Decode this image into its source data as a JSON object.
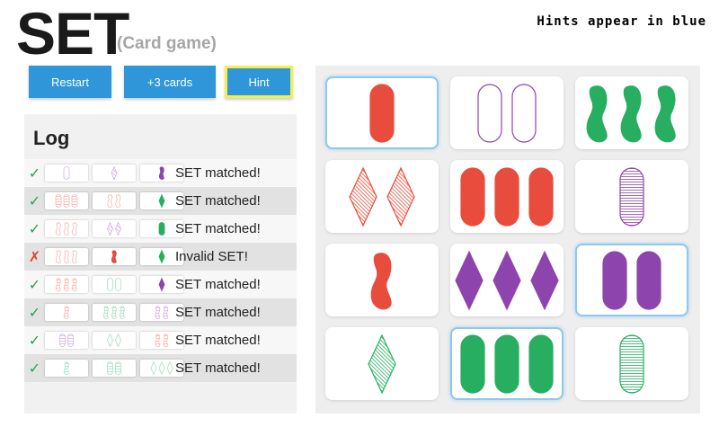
{
  "header": {
    "title": "SET",
    "subtitle": "(Card game)",
    "hint_note": "Hints appear in blue"
  },
  "toolbar": {
    "restart_label": "Restart",
    "add_cards_label": "+3 cards",
    "hint_label": "Hint"
  },
  "colors": {
    "red": "#e74c3c",
    "purple": "#8e44ad",
    "green": "#27ae60",
    "button": "#2f97d9",
    "hint_outline": "#f5ef4a",
    "hint_card": "#8dc8ee"
  },
  "log": {
    "title": "Log",
    "entries": [
      {
        "valid": true,
        "mark": "✓",
        "text": "SET matched!",
        "cards": [
          {
            "color": "purple",
            "shape": "oval",
            "fill": "empty",
            "count": 1,
            "faded": true
          },
          {
            "color": "purple",
            "shape": "diamond",
            "fill": "striped",
            "count": 1,
            "faded": true
          },
          {
            "color": "purple",
            "shape": "squiggle",
            "fill": "solid",
            "count": 1,
            "faded": false
          }
        ]
      },
      {
        "valid": true,
        "mark": "✓",
        "text": "SET matched!",
        "cards": [
          {
            "color": "red",
            "shape": "oval",
            "fill": "striped",
            "count": 3,
            "faded": true
          },
          {
            "color": "red",
            "shape": "squiggle",
            "fill": "empty",
            "count": 2,
            "faded": true
          },
          {
            "color": "green",
            "shape": "diamond",
            "fill": "solid",
            "count": 1,
            "faded": false
          }
        ]
      },
      {
        "valid": true,
        "mark": "✓",
        "text": "SET matched!",
        "cards": [
          {
            "color": "red",
            "shape": "squiggle",
            "fill": "empty",
            "count": 3,
            "faded": true
          },
          {
            "color": "purple",
            "shape": "diamond",
            "fill": "striped",
            "count": 2,
            "faded": true
          },
          {
            "color": "green",
            "shape": "oval",
            "fill": "solid",
            "count": 1,
            "faded": false
          }
        ]
      },
      {
        "valid": false,
        "mark": "✗",
        "text": "Invalid SET!",
        "cards": [
          {
            "color": "red",
            "shape": "squiggle",
            "fill": "empty",
            "count": 3,
            "faded": true
          },
          {
            "color": "red",
            "shape": "squiggle",
            "fill": "solid",
            "count": 1,
            "faded": false
          },
          {
            "color": "green",
            "shape": "diamond",
            "fill": "solid",
            "count": 1,
            "faded": false
          }
        ]
      },
      {
        "valid": true,
        "mark": "✓",
        "text": "SET matched!",
        "cards": [
          {
            "color": "red",
            "shape": "squiggle",
            "fill": "striped",
            "count": 3,
            "faded": true
          },
          {
            "color": "green",
            "shape": "oval",
            "fill": "empty",
            "count": 2,
            "faded": true
          },
          {
            "color": "purple",
            "shape": "diamond",
            "fill": "solid",
            "count": 1,
            "faded": false
          }
        ]
      },
      {
        "valid": true,
        "mark": "✓",
        "text": "SET matched!",
        "cards": [
          {
            "color": "red",
            "shape": "squiggle",
            "fill": "striped",
            "count": 1,
            "faded": true
          },
          {
            "color": "green",
            "shape": "squiggle",
            "fill": "striped",
            "count": 3,
            "faded": true
          },
          {
            "color": "purple",
            "shape": "squiggle",
            "fill": "striped",
            "count": 2,
            "faded": true
          }
        ]
      },
      {
        "valid": true,
        "mark": "✓",
        "text": "SET matched!",
        "cards": [
          {
            "color": "purple",
            "shape": "oval",
            "fill": "striped",
            "count": 2,
            "faded": true
          },
          {
            "color": "green",
            "shape": "diamond",
            "fill": "empty",
            "count": 2,
            "faded": true
          },
          {
            "color": "red",
            "shape": "squiggle",
            "fill": "striped",
            "count": 2,
            "faded": true
          }
        ]
      },
      {
        "valid": true,
        "mark": "✓",
        "text": "SET matched!",
        "cards": [
          {
            "color": "green",
            "shape": "squiggle",
            "fill": "striped",
            "count": 1,
            "faded": true
          },
          {
            "color": "green",
            "shape": "oval",
            "fill": "striped",
            "count": 2,
            "faded": true
          },
          {
            "color": "green",
            "shape": "diamond",
            "fill": "empty",
            "count": 3,
            "faded": true
          }
        ]
      }
    ]
  },
  "board": {
    "cards": [
      {
        "color": "red",
        "shape": "oval",
        "fill": "solid",
        "count": 1,
        "hinted": true
      },
      {
        "color": "purple",
        "shape": "oval",
        "fill": "empty",
        "count": 2,
        "hinted": false
      },
      {
        "color": "green",
        "shape": "squiggle",
        "fill": "solid",
        "count": 3,
        "hinted": false
      },
      {
        "color": "red",
        "shape": "diamond",
        "fill": "striped",
        "count": 2,
        "hinted": false
      },
      {
        "color": "red",
        "shape": "oval",
        "fill": "solid",
        "count": 3,
        "hinted": false
      },
      {
        "color": "purple",
        "shape": "oval",
        "fill": "striped",
        "count": 1,
        "hinted": false
      },
      {
        "color": "red",
        "shape": "squiggle",
        "fill": "solid",
        "count": 1,
        "hinted": false
      },
      {
        "color": "purple",
        "shape": "diamond",
        "fill": "solid",
        "count": 3,
        "hinted": false
      },
      {
        "color": "purple",
        "shape": "oval",
        "fill": "solid",
        "count": 2,
        "hinted": true
      },
      {
        "color": "green",
        "shape": "diamond",
        "fill": "striped",
        "count": 1,
        "hinted": false
      },
      {
        "color": "green",
        "shape": "oval",
        "fill": "solid",
        "count": 3,
        "hinted": true
      },
      {
        "color": "green",
        "shape": "oval",
        "fill": "striped",
        "count": 1,
        "hinted": false
      }
    ]
  }
}
